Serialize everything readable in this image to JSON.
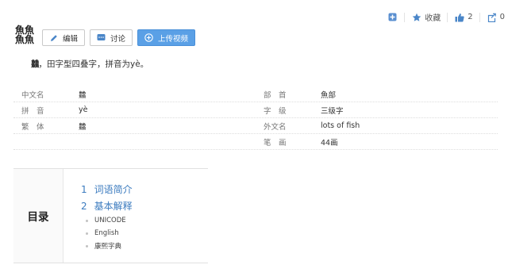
{
  "topbar": {
    "favorite_label": "收藏",
    "like_count": "2",
    "share_count": "0"
  },
  "title": {
    "glyph_icon": "four-fish-character-icon",
    "edit_label": "编辑",
    "discuss_label": "讨论",
    "upload_label": "上传视频"
  },
  "summary": {
    "glyph_text": "䲜",
    "text": "，田字型四叠字，拼音为yè。"
  },
  "info": {
    "rows": [
      {
        "lk": "中文名",
        "lv": "䲜",
        "rk": "部　首",
        "rv": "魚部"
      },
      {
        "lk": "拼　音",
        "lv": "yè",
        "rk": "字　级",
        "rv": "三级字"
      },
      {
        "lk": "繁　体",
        "lv": "䲜",
        "rk": "外文名",
        "rv": "lots of fish"
      },
      {
        "lk": "",
        "lv": "",
        "rk": "笔　画",
        "rv": "44画"
      }
    ]
  },
  "toc": {
    "heading": "目录",
    "sections": [
      {
        "num": "1",
        "label": "词语简介"
      },
      {
        "num": "2",
        "label": "基本解释"
      }
    ],
    "subitems": [
      "UNICODE",
      "English",
      "康熙字典"
    ]
  },
  "colors": {
    "accent": "#3b7bbf",
    "upload_button": "#5aa0e6"
  }
}
